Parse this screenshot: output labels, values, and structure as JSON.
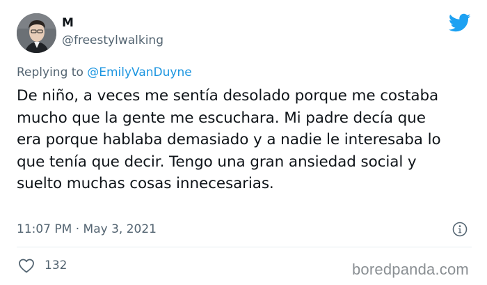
{
  "tweet": {
    "display_name": "M",
    "handle": "@freestylwalking",
    "replying_prefix": "Replying to",
    "replying_to": "@EmilyVanDuyne",
    "text_lines": [
      "De niño, a veces me sentía desolado porque me costaba",
      "mucho que la gente me escuchara. Mi padre decía que",
      "era porque hablaba demasiado y a nadie le interesaba lo",
      "que tenía que decir. Tengo una gran ansiedad social y",
      "suelto muchas cosas innecesarias."
    ],
    "timestamp": "11:07 PM · May 3, 2021",
    "like_count": "132"
  },
  "icons": {
    "brand": "twitter-bird-icon",
    "info": "info-icon",
    "like": "heart-icon"
  },
  "colors": {
    "twitter_blue": "#1da1f2",
    "mention": "#1b95e0",
    "secondary_text": "#536471",
    "primary_text": "#0f1419"
  },
  "watermark": "boredpanda.com"
}
